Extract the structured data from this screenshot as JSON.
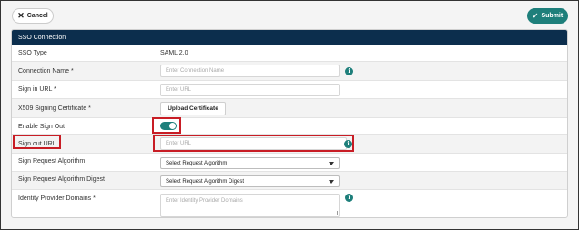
{
  "toolbar": {
    "cancel_label": "Cancel",
    "submit_label": "Submit"
  },
  "panel": {
    "title": "SSO Connection"
  },
  "form": {
    "sso_type": {
      "label": "SSO Type",
      "value": "SAML 2.0"
    },
    "connection_name": {
      "label": "Connection Name",
      "required": "*",
      "placeholder": "Enter Connection Name"
    },
    "sign_in_url": {
      "label": "Sign in URL",
      "required": "*",
      "placeholder": "Enter URL"
    },
    "x509_cert": {
      "label": "X509 Signing Certificate",
      "required": "*",
      "button_label": "Upload Certificate"
    },
    "enable_sign_out": {
      "label": "Enable Sign Out",
      "enabled": true
    },
    "sign_out_url": {
      "label": "Sign out URL",
      "placeholder": "Enter URL"
    },
    "sign_request_algorithm": {
      "label": "Sign Request Algorithm",
      "selected": "Select Request Algorithm"
    },
    "sign_request_algorithm_digest": {
      "label": "Sign Request Algorithm Digest",
      "selected": "Select Request Algorithm Digest"
    },
    "identity_provider_domains": {
      "label": "Identity Provider Domains",
      "required": "*",
      "placeholder": "Enter Identity Provider Domains"
    }
  },
  "icons": {
    "info": "info-icon",
    "info_glyph": "i",
    "cancel": "close-icon",
    "cancel_glyph": "✕",
    "submit": "check-icon",
    "submit_glyph": "✓"
  },
  "colors": {
    "header_bg": "#0c2e4d",
    "accent": "#1e7f7b",
    "highlight": "#c81d25"
  }
}
